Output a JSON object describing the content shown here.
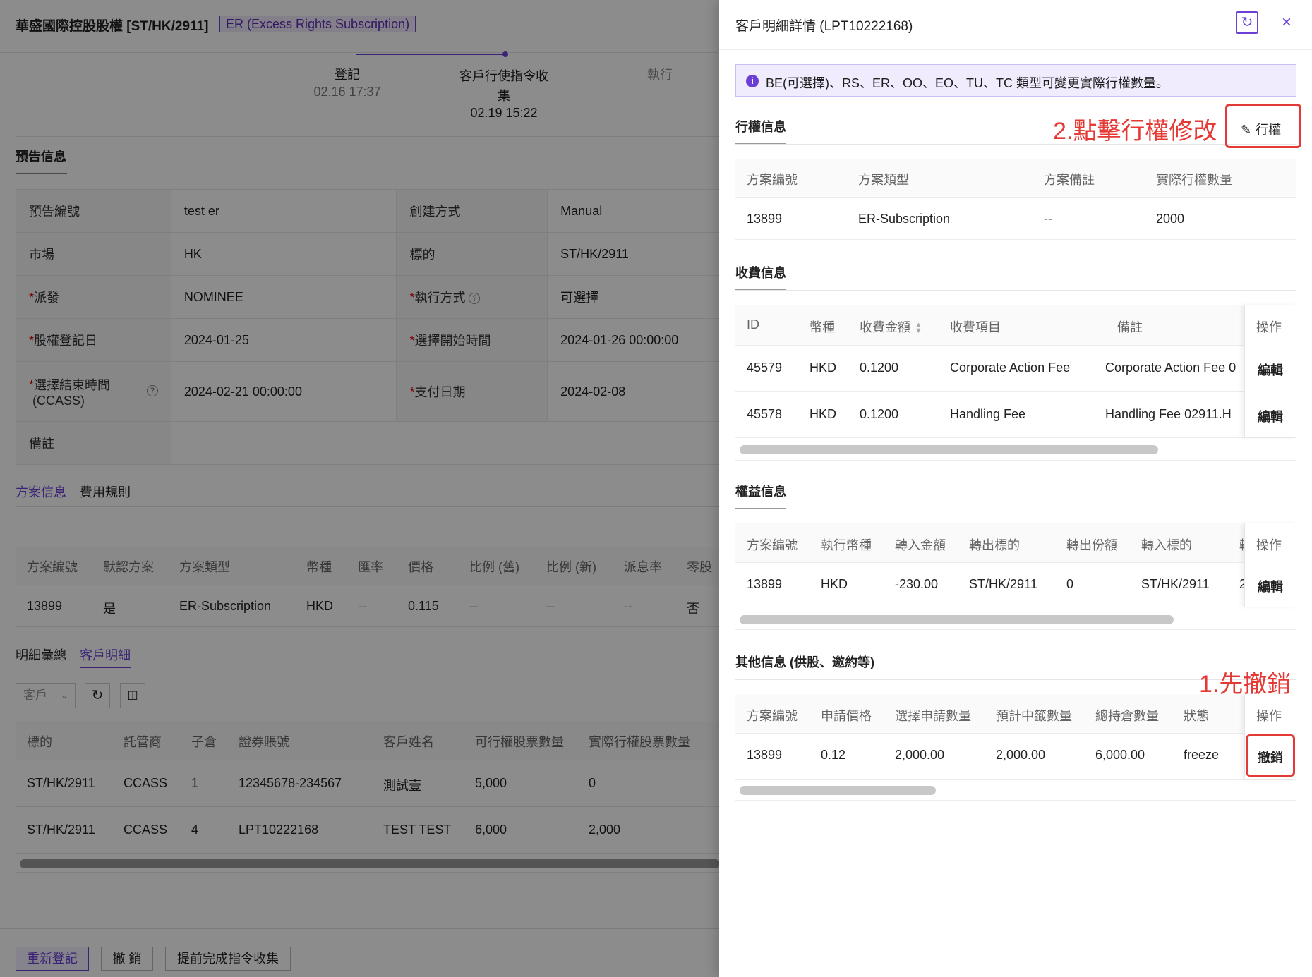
{
  "background": {
    "title": "華盛國際控股股權 [ST/HK/2911]",
    "tag": "ER (Excess Rights Subscription)",
    "steps": [
      {
        "label": "登記",
        "time": "02.16 17:37"
      },
      {
        "label_line1": "客戶行使指令收",
        "label_line2": "集",
        "time": "02.19 15:22"
      },
      {
        "label": "執行"
      }
    ],
    "notice_title": "預告信息",
    "info": {
      "r1": {
        "k1": "預告編號",
        "v1": "test er",
        "k2": "創建方式",
        "v2": "Manual"
      },
      "r2": {
        "k1": "市場",
        "v1": "HK",
        "k2": "標的",
        "v2": "ST/HK/2911"
      },
      "r3": {
        "k1": "派發",
        "v1": "NOMINEE",
        "k2": "執行方式",
        "v2": "可選擇"
      },
      "r4": {
        "k1": "股權登記日",
        "v1": "2024-01-25",
        "k2": "選擇開始時間",
        "v2": "2024-01-26 00:00:00"
      },
      "r5": {
        "k1a": "選擇結束時間",
        "k1b": "(CCASS)",
        "v1": "2024-02-21 00:00:00",
        "k2": "支付日期",
        "v2": "2024-02-08"
      },
      "r6": {
        "k1": "備註"
      }
    },
    "tabs1": [
      "方案信息",
      "費用規則"
    ],
    "scheme_headers": [
      "方案編號",
      "默認方案",
      "方案類型",
      "幣種",
      "匯率",
      "價格",
      "比例 (舊)",
      "比例 (新)",
      "派息率",
      "零股"
    ],
    "scheme_row": [
      "13899",
      "是",
      "ER-Subscription",
      "HKD",
      "--",
      "0.115",
      "--",
      "--",
      "--",
      "否"
    ],
    "tabs2": [
      "明細彙總",
      "客戶明細"
    ],
    "filter_placeholder": "客戶",
    "client_headers": [
      "標的",
      "託管商",
      "子倉",
      "證券賬號",
      "客戶姓名",
      "可行權股票數量",
      "實際行權股票數量"
    ],
    "client_rows": [
      [
        "ST/HK/2911",
        "CCASS",
        "1",
        "12345678-234567",
        "測試壹",
        "5,000",
        "0"
      ],
      [
        "ST/HK/2911",
        "CCASS",
        "4",
        "LPT10222168",
        "TEST TEST",
        "6,000",
        "2,000"
      ]
    ],
    "footer_buttons": [
      "重新登記",
      "撤 銷",
      "提前完成指令收集"
    ]
  },
  "drawer": {
    "title": "客戶明細詳情 (LPT10222168)",
    "alert": "BE(可選擇)、RS、ER、OO、EO、TU、TC 類型可變更實際行權數量。",
    "exercise": {
      "title": "行權信息",
      "button": "行權",
      "headers": [
        "方案編號",
        "方案類型",
        "方案備註",
        "實際行權數量"
      ],
      "row": [
        "13899",
        "ER-Subscription",
        "--",
        "2000"
      ]
    },
    "fee": {
      "title": "收費信息",
      "headers": [
        "ID",
        "幣種",
        "收費金額",
        "收費項目",
        "備註",
        "操作"
      ],
      "rows": [
        [
          "45579",
          "HKD",
          "0.1200",
          "Corporate Action Fee",
          "Corporate Action Fee 0",
          "編輯"
        ],
        [
          "45578",
          "HKD",
          "0.1200",
          "Handling Fee",
          "Handling Fee 02911.H",
          "編輯"
        ]
      ]
    },
    "rights": {
      "title": "權益信息",
      "headers": [
        "方案編號",
        "執行幣種",
        "轉入金額",
        "轉出標的",
        "轉出份額",
        "轉入標的",
        "轉",
        "操作"
      ],
      "row": [
        "13899",
        "HKD",
        "-230.00",
        "ST/HK/2911",
        "0",
        "ST/HK/2911",
        "2",
        "編輯"
      ]
    },
    "other": {
      "title": "其他信息 (供股、邀約等)",
      "headers": [
        "方案編號",
        "申請價格",
        "選擇申請數量",
        "預計中籤數量",
        "總持倉數量",
        "狀態",
        "操作"
      ],
      "row": [
        "13899",
        "0.12",
        "2,000.00",
        "2,000.00",
        "6,000.00",
        "freeze",
        "撤銷"
      ]
    },
    "annotation_2": "2.點擊行權修改",
    "annotation_1": "1.先撤銷"
  },
  "colors": {
    "accent": "#6b3fd4",
    "annotation": "#e53935",
    "alert_bg": "#f1ecfd"
  }
}
